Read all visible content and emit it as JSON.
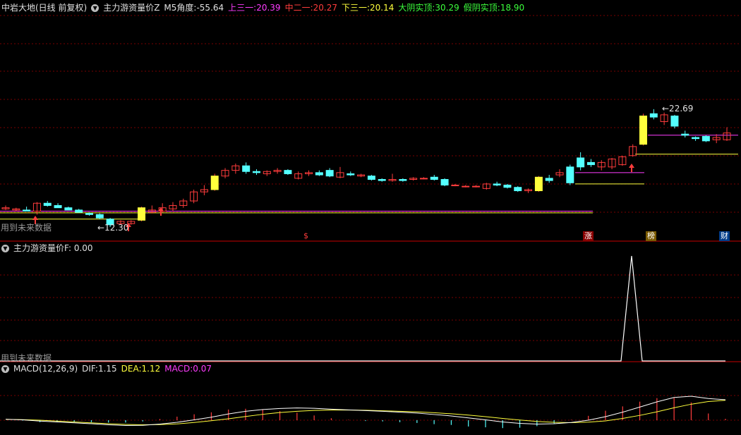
{
  "main": {
    "stock_name": "中岩大地(日线 前复权)",
    "indicator_name": "主力游资量价Z",
    "m5_label": "M5角度:",
    "m5_value": "-55.64",
    "up3_label": "上三一:",
    "up3_value": "20.39",
    "mid2_label": "中二一:",
    "mid2_value": "20.27",
    "low3_label": "下三一:",
    "low3_value": "20.14",
    "bigyin_label": "大阴实顶:",
    "bigyin_value": "30.29",
    "fakeyin_label": "假阴实顶:",
    "fakeyin_value": "18.90",
    "future_note": "用到未来数据",
    "high_label": "22.69",
    "low_label": "12.30",
    "markers": [
      "$",
      "涨",
      "榜",
      "财"
    ]
  },
  "sub1": {
    "indicator_name": "主力游资量价F",
    "value_label": ": 0.00",
    "future_note": "用到未来数据"
  },
  "macd": {
    "indicator_name": "MACD(12,26,9)",
    "dif_label": "DIF:",
    "dif_value": "1.15",
    "dea_label": "DEA:",
    "dea_value": "1.12",
    "macd_label": "MACD:",
    "macd_value": "0.07"
  },
  "colors": {
    "up": "#ff3c3c",
    "down": "#54ffff",
    "yellow": "#ffff3c",
    "magenta": "#ff3cff",
    "white": "#ffffff",
    "grid": "#7a0000",
    "divider": "#c80000"
  },
  "chart_data": {
    "type": "candlestick",
    "candles": [
      {
        "o": 13.9,
        "h": 14.2,
        "l": 13.8,
        "c": 14.0
      },
      {
        "o": 13.8,
        "h": 14.0,
        "l": 13.7,
        "c": 13.9
      },
      {
        "o": 13.8,
        "h": 14.1,
        "l": 13.7,
        "c": 13.7
      },
      {
        "o": 13.7,
        "h": 14.5,
        "l": 13.4,
        "c": 14.4
      },
      {
        "o": 14.4,
        "h": 14.6,
        "l": 14.1,
        "c": 14.2
      },
      {
        "o": 14.2,
        "h": 14.4,
        "l": 14.0,
        "c": 14.0
      },
      {
        "o": 14.0,
        "h": 14.1,
        "l": 13.8,
        "c": 13.8
      },
      {
        "o": 13.8,
        "h": 13.9,
        "l": 13.6,
        "c": 13.6
      },
      {
        "o": 13.5,
        "h": 13.6,
        "l": 13.3,
        "c": 13.4
      },
      {
        "o": 13.4,
        "h": 13.5,
        "l": 13.0,
        "c": 13.1
      },
      {
        "o": 13.0,
        "h": 13.1,
        "l": 12.3,
        "c": 12.5
      },
      {
        "o": 12.6,
        "h": 12.9,
        "l": 12.5,
        "c": 12.8
      },
      {
        "o": 12.6,
        "h": 12.9,
        "l": 12.5,
        "c": 12.8
      },
      {
        "o": 12.9,
        "h": 14.1,
        "l": 12.8,
        "c": 14.0
      },
      {
        "o": 13.6,
        "h": 14.2,
        "l": 13.5,
        "c": 13.8
      },
      {
        "o": 13.7,
        "h": 14.4,
        "l": 13.6,
        "c": 14.0
      },
      {
        "o": 13.9,
        "h": 14.5,
        "l": 13.7,
        "c": 14.2
      },
      {
        "o": 14.2,
        "h": 14.8,
        "l": 14.0,
        "c": 14.6
      },
      {
        "o": 14.6,
        "h": 15.6,
        "l": 14.4,
        "c": 15.4
      },
      {
        "o": 15.4,
        "h": 16.0,
        "l": 15.1,
        "c": 15.6
      },
      {
        "o": 15.6,
        "h": 17.0,
        "l": 15.5,
        "c": 16.8
      },
      {
        "o": 16.8,
        "h": 17.5,
        "l": 16.6,
        "c": 17.3
      },
      {
        "o": 17.3,
        "h": 17.9,
        "l": 17.0,
        "c": 17.7
      },
      {
        "o": 17.7,
        "h": 18.0,
        "l": 17.0,
        "c": 17.2
      },
      {
        "o": 17.2,
        "h": 17.4,
        "l": 16.9,
        "c": 17.1
      },
      {
        "o": 17.0,
        "h": 17.3,
        "l": 16.8,
        "c": 17.2
      },
      {
        "o": 17.2,
        "h": 17.5,
        "l": 17.0,
        "c": 17.3
      },
      {
        "o": 17.3,
        "h": 17.4,
        "l": 16.9,
        "c": 17.0
      },
      {
        "o": 16.6,
        "h": 17.2,
        "l": 16.5,
        "c": 17.0
      },
      {
        "o": 17.0,
        "h": 17.3,
        "l": 16.8,
        "c": 17.1
      },
      {
        "o": 17.1,
        "h": 17.3,
        "l": 16.8,
        "c": 16.9
      },
      {
        "o": 17.3,
        "h": 17.5,
        "l": 16.7,
        "c": 16.8
      },
      {
        "o": 16.7,
        "h": 17.6,
        "l": 16.6,
        "c": 17.1
      },
      {
        "o": 17.0,
        "h": 17.2,
        "l": 16.8,
        "c": 16.9
      },
      {
        "o": 16.8,
        "h": 17.0,
        "l": 16.7,
        "c": 16.9
      },
      {
        "o": 16.8,
        "h": 16.9,
        "l": 16.4,
        "c": 16.5
      },
      {
        "o": 16.5,
        "h": 16.6,
        "l": 16.3,
        "c": 16.4
      },
      {
        "o": 16.4,
        "h": 17.0,
        "l": 16.3,
        "c": 16.5
      },
      {
        "o": 16.5,
        "h": 16.6,
        "l": 16.3,
        "c": 16.4
      },
      {
        "o": 16.5,
        "h": 16.7,
        "l": 16.4,
        "c": 16.6
      },
      {
        "o": 16.6,
        "h": 16.7,
        "l": 16.5,
        "c": 16.6
      },
      {
        "o": 16.7,
        "h": 16.9,
        "l": 16.4,
        "c": 16.5
      },
      {
        "o": 16.5,
        "h": 16.6,
        "l": 15.9,
        "c": 16.0
      },
      {
        "o": 16.0,
        "h": 16.1,
        "l": 15.9,
        "c": 16.0
      },
      {
        "o": 15.9,
        "h": 16.0,
        "l": 15.8,
        "c": 15.9
      },
      {
        "o": 15.9,
        "h": 16.0,
        "l": 15.8,
        "c": 15.9
      },
      {
        "o": 15.7,
        "h": 16.2,
        "l": 15.6,
        "c": 16.1
      },
      {
        "o": 16.1,
        "h": 16.3,
        "l": 15.9,
        "c": 16.0
      },
      {
        "o": 16.0,
        "h": 16.1,
        "l": 15.7,
        "c": 15.8
      },
      {
        "o": 15.8,
        "h": 15.9,
        "l": 15.4,
        "c": 15.5
      },
      {
        "o": 15.5,
        "h": 15.7,
        "l": 15.3,
        "c": 15.6
      },
      {
        "o": 15.5,
        "h": 16.8,
        "l": 15.4,
        "c": 16.7
      },
      {
        "o": 16.6,
        "h": 16.9,
        "l": 16.2,
        "c": 16.4
      },
      {
        "o": 16.9,
        "h": 17.4,
        "l": 16.7,
        "c": 17.1
      },
      {
        "o": 17.6,
        "h": 17.8,
        "l": 16.0,
        "c": 16.2
      },
      {
        "o": 18.4,
        "h": 18.9,
        "l": 17.3,
        "c": 17.6
      },
      {
        "o": 18.0,
        "h": 18.3,
        "l": 17.6,
        "c": 17.8
      },
      {
        "o": 17.6,
        "h": 18.2,
        "l": 17.3,
        "c": 18.0
      },
      {
        "o": 17.6,
        "h": 18.4,
        "l": 17.4,
        "c": 18.3
      },
      {
        "o": 17.8,
        "h": 18.6,
        "l": 17.7,
        "c": 18.5
      },
      {
        "o": 18.6,
        "h": 19.6,
        "l": 18.5,
        "c": 19.4
      },
      {
        "o": 19.6,
        "h": 22.3,
        "l": 19.5,
        "c": 22.1
      },
      {
        "o": 22.3,
        "h": 22.7,
        "l": 21.8,
        "c": 22.0
      },
      {
        "o": 21.6,
        "h": 22.4,
        "l": 21.3,
        "c": 22.2
      },
      {
        "o": 22.1,
        "h": 22.2,
        "l": 21.0,
        "c": 21.2
      },
      {
        "o": 20.5,
        "h": 20.8,
        "l": 20.2,
        "c": 20.4
      },
      {
        "o": 20.2,
        "h": 20.3,
        "l": 19.9,
        "c": 20.1
      },
      {
        "o": 20.3,
        "h": 20.4,
        "l": 19.8,
        "c": 19.9
      },
      {
        "o": 20.0,
        "h": 20.5,
        "l": 19.7,
        "c": 20.2
      },
      {
        "o": 20.0,
        "h": 21.1,
        "l": 19.9,
        "c": 20.6
      }
    ],
    "levels": {
      "yellow_line": 20.1,
      "magenta_line": 20.4
    },
    "sub_indicator_peak_value": 1,
    "macd": {
      "dif": [
        0.05,
        0.02,
        -0.05,
        -0.1,
        -0.15,
        -0.2,
        -0.26,
        -0.3,
        -0.29,
        -0.22,
        -0.12,
        0.02,
        0.17,
        0.35,
        0.5,
        0.6,
        0.66,
        0.69,
        0.67,
        0.62,
        0.58,
        0.54,
        0.5,
        0.45,
        0.4,
        0.32,
        0.24,
        0.13,
        0.02,
        -0.1,
        -0.18,
        -0.22,
        -0.2,
        -0.13,
        0.0,
        0.2,
        0.45,
        0.74,
        1.03,
        1.28,
        1.35,
        1.22,
        1.15
      ],
      "dea": [
        0.05,
        0.03,
        0.0,
        -0.05,
        -0.1,
        -0.15,
        -0.2,
        -0.24,
        -0.26,
        -0.25,
        -0.21,
        -0.13,
        -0.03,
        0.08,
        0.21,
        0.33,
        0.43,
        0.5,
        0.55,
        0.57,
        0.57,
        0.56,
        0.53,
        0.5,
        0.47,
        0.42,
        0.36,
        0.29,
        0.2,
        0.1,
        0.01,
        -0.07,
        -0.12,
        -0.14,
        -0.11,
        -0.04,
        0.1,
        0.27,
        0.47,
        0.7,
        0.9,
        1.05,
        1.12
      ],
      "hist": [
        0.0,
        -0.02,
        -0.1,
        -0.1,
        -0.1,
        -0.1,
        -0.12,
        -0.12,
        -0.06,
        0.06,
        0.18,
        0.3,
        0.4,
        0.54,
        0.58,
        0.54,
        0.46,
        0.38,
        0.24,
        0.1,
        0.02,
        -0.04,
        -0.06,
        -0.1,
        -0.14,
        -0.2,
        -0.24,
        -0.32,
        -0.36,
        -0.4,
        -0.38,
        -0.3,
        -0.16,
        0.02,
        0.22,
        0.48,
        0.7,
        0.94,
        1.12,
        1.16,
        0.9,
        0.34,
        0.07
      ]
    }
  }
}
